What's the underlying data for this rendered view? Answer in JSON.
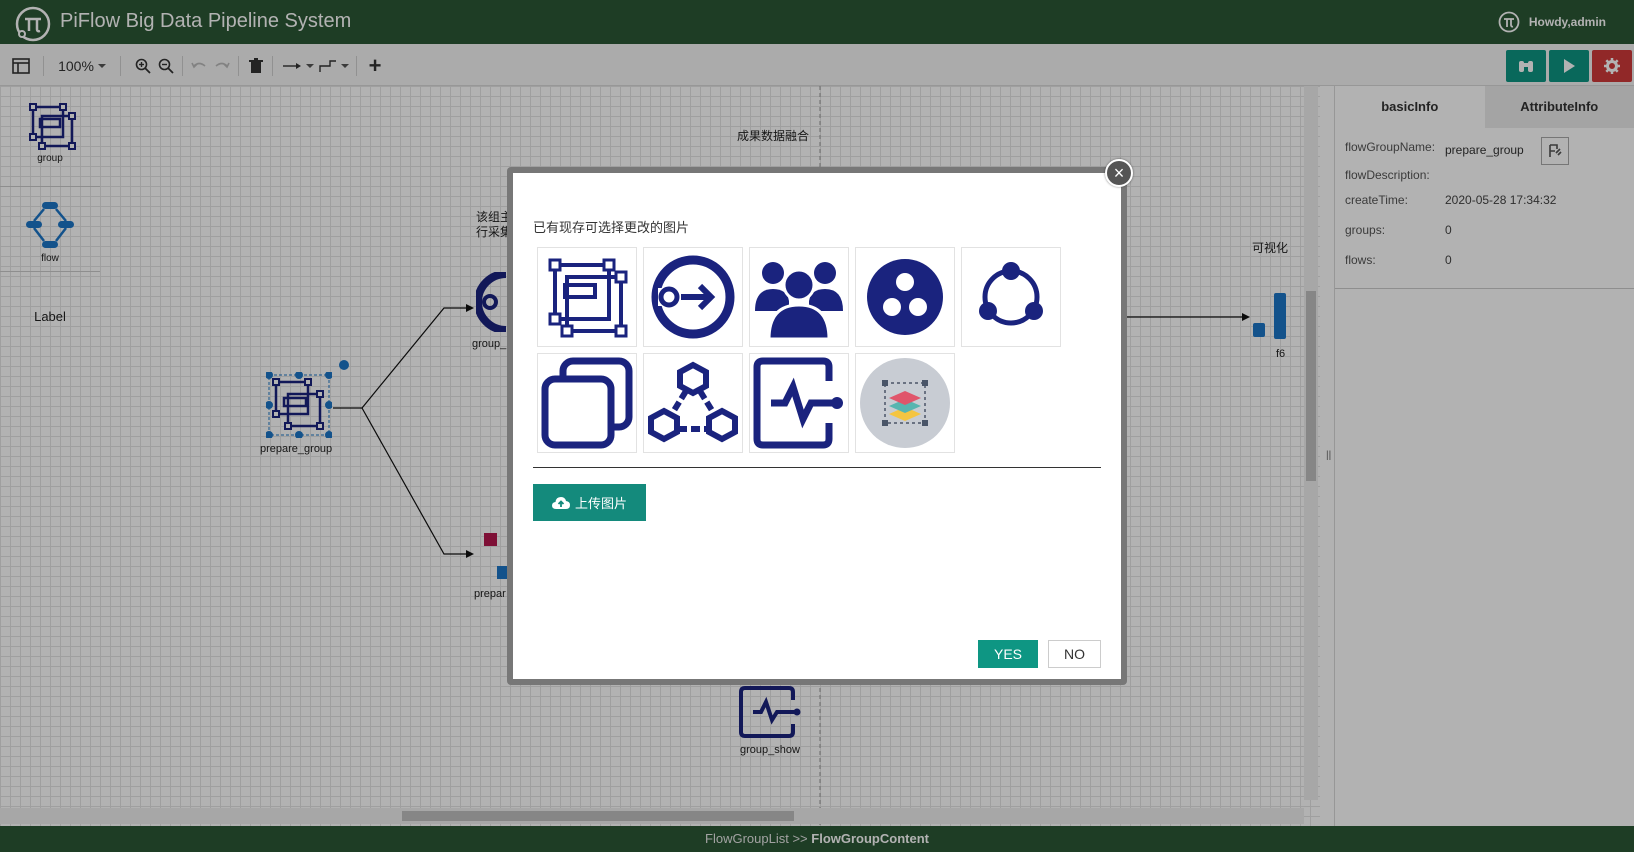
{
  "header": {
    "title": "PiFlow Big Data Pipeline System",
    "user_greeting": "Howdy,admin",
    "background_color": "#2b5835"
  },
  "toolbar": {
    "zoom_value": "100%",
    "add_label": "+",
    "action_button_colors": [
      "#0e9683",
      "#0e9683",
      "#d03a3a"
    ]
  },
  "palette": {
    "group_label": "group",
    "flow_label": "flow",
    "label_item": "Label"
  },
  "canvas": {
    "node_prepare_group": "prepare_group",
    "node_group_partial": "group_",
    "node_prepare_partial": "prepar",
    "node_group_show": "group_show",
    "text_merge": "成果数据融合",
    "text_partial_line1": "该组主",
    "text_partial_line2": "行采集",
    "text_visual_partial": "可视化",
    "node_f6": "f6",
    "icon_color": "#1a237e"
  },
  "right_panel": {
    "tabs": [
      {
        "label": "basicInfo",
        "active": true
      },
      {
        "label": "AttributeInfo",
        "active": false
      }
    ],
    "info": {
      "flowGroupName_label": "flowGroupName:",
      "flowGroupName_value": "prepare_group",
      "flowDescription_label": "flowDescription:",
      "createTime_label": "createTime:",
      "createTime_value": "2020-05-28 17:34:32",
      "groups_label": "groups:",
      "groups_value": "0",
      "flows_label": "flows:",
      "flows_value": "0"
    }
  },
  "modal": {
    "title": "已有现存可选择更改的图片",
    "images": [
      "group-frame-icon",
      "arrow-in-circle-icon",
      "users-group-icon",
      "three-dots-circle-icon",
      "share-network-icon",
      "copy-squares-icon",
      "hexagon-network-icon",
      "activity-monitor-icon",
      "layers-stack-icon"
    ],
    "upload_label": "上传图片",
    "yes_label": "YES",
    "no_label": "NO",
    "close_symbol": "×"
  },
  "footer": {
    "breadcrumb_parent": "FlowGroupList",
    "breadcrumb_sep": ">>",
    "breadcrumb_current": "FlowGroupContent"
  }
}
